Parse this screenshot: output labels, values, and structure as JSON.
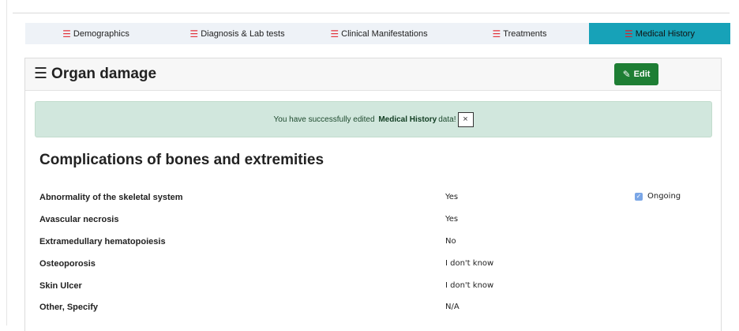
{
  "tabs": [
    {
      "label": "Demographics",
      "active": false
    },
    {
      "label": "Diagnosis & Lab tests",
      "active": false
    },
    {
      "label": "Clinical Manifestations",
      "active": false
    },
    {
      "label": "Treatments",
      "active": false
    },
    {
      "label": "Medical History",
      "active": true
    }
  ],
  "icons": {
    "list": "☰",
    "edit": "✎",
    "check": "✓",
    "close": "×"
  },
  "colors": {
    "tab_icon": "#e3343d",
    "active_tab": "#17a2b8",
    "edit_button": "#1e7e34",
    "alert_bg": "#d1e7dd"
  },
  "card": {
    "title": "Organ damage",
    "edit_label": "Edit"
  },
  "alert": {
    "prefix": "You have successfully edited",
    "bold": "Medical History",
    "suffix": "data!",
    "close": "×"
  },
  "section": {
    "title": "Complications of bones and extremities"
  },
  "rows": [
    {
      "label": "Abnormality of the skeletal system",
      "value": "Yes",
      "ongoing": "Ongoing"
    },
    {
      "label": "Avascular necrosis",
      "value": "Yes"
    },
    {
      "label": "Extramedullary hematopoiesis",
      "value": "No"
    },
    {
      "label": "Osteoporosis",
      "value": "I don't know"
    },
    {
      "label": "Skin Ulcer",
      "value": "I don't know"
    },
    {
      "label": "Other, Specify",
      "value": "N/A"
    }
  ]
}
